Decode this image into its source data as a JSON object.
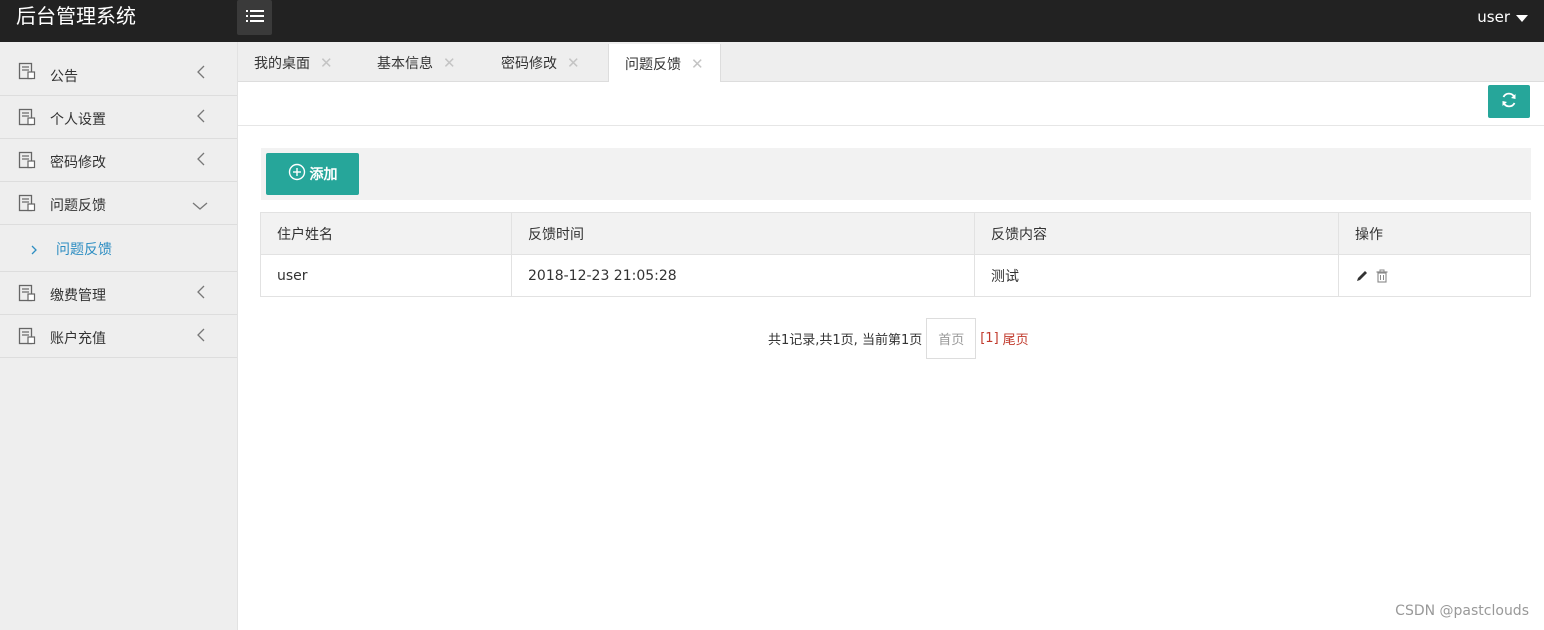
{
  "header": {
    "title": "后台管理系统",
    "user": "user"
  },
  "sidebar": {
    "items": [
      {
        "label": "公告"
      },
      {
        "label": "个人设置"
      },
      {
        "label": "密码修改"
      },
      {
        "label": "问题反馈"
      }
    ],
    "sub_items": [
      {
        "label": "问题反馈"
      }
    ],
    "items_after": [
      {
        "label": "缴费管理"
      },
      {
        "label": "账户充值"
      }
    ]
  },
  "tabs": [
    {
      "label": "我的桌面"
    },
    {
      "label": "基本信息"
    },
    {
      "label": "密码修改"
    },
    {
      "label": "问题反馈",
      "active": true
    }
  ],
  "toolbar": {
    "add_label": "添加"
  },
  "table": {
    "headers": [
      "住户姓名",
      "反馈时间",
      "反馈内容",
      "操作"
    ],
    "rows": [
      {
        "name": "user",
        "time": "2018-12-23 21:05:28",
        "content": "测试"
      }
    ]
  },
  "pager": {
    "summary": "共1记录,共1页, 当前第1页",
    "first": "首页",
    "current": "[1]",
    "last": "尾页"
  },
  "watermark": "CSDN @pastclouds",
  "colors": {
    "header_bg": "#222222",
    "accent": "#26a69a",
    "link": "#2e8ec2",
    "pager_red": "#c0392b"
  }
}
